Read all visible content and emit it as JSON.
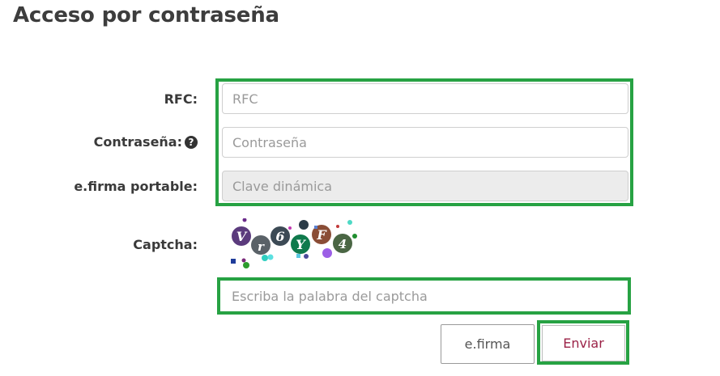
{
  "page": {
    "title": "Acceso por contraseña"
  },
  "form": {
    "rfc": {
      "label": "RFC:",
      "placeholder": "RFC"
    },
    "password": {
      "label": "Contraseña:",
      "placeholder": "Contraseña",
      "help_icon": "question-circle-icon"
    },
    "efirma_portable": {
      "label": "e.firma portable:",
      "placeholder": "Clave dinámica"
    },
    "captcha": {
      "label": "Captcha:",
      "input_placeholder": "Escriba la palabra del captcha"
    }
  },
  "buttons": {
    "efirma": "e.firma",
    "enviar": "Enviar"
  },
  "colors": {
    "highlight": "#27a243",
    "primary_text": "#9b2247",
    "disabled_bg": "#ececec"
  }
}
